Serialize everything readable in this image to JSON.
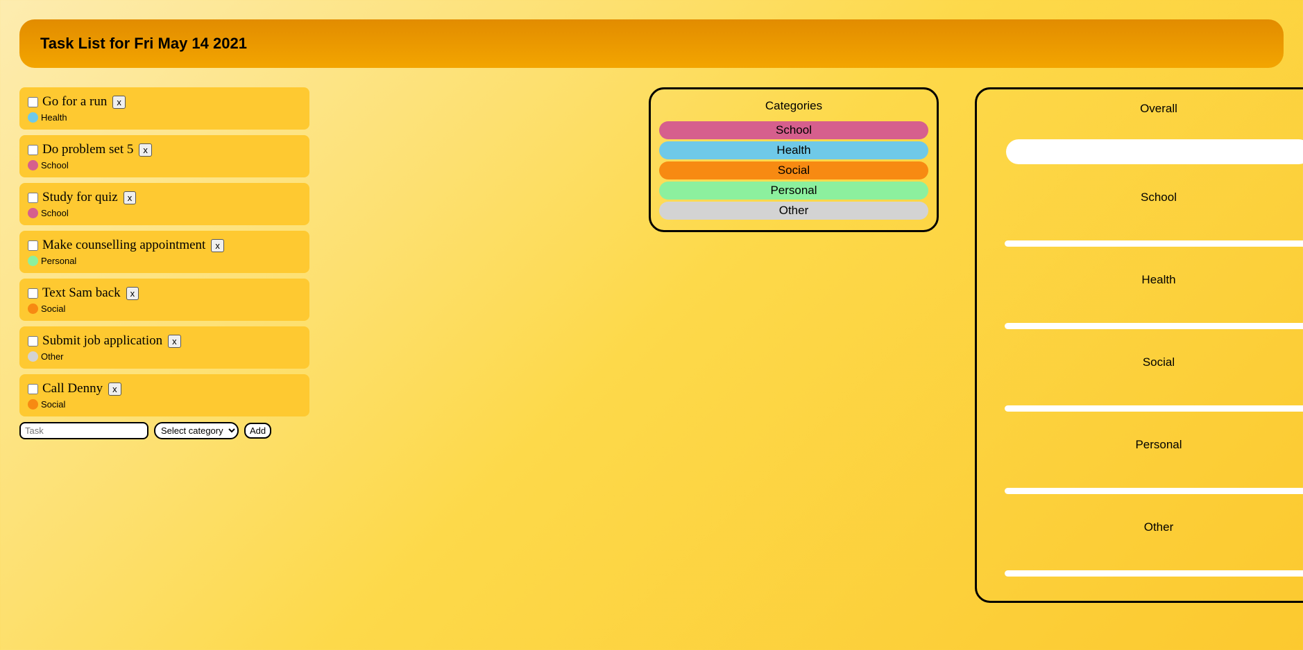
{
  "header": {
    "title": "Task List for Fri May 14 2021"
  },
  "tasks": [
    {
      "label": "Go for a run",
      "category": "Health",
      "color": "#6fc9e8"
    },
    {
      "label": "Do problem set 5",
      "category": "School",
      "color": "#d65f8d"
    },
    {
      "label": "Study for quiz",
      "category": "School",
      "color": "#d65f8d"
    },
    {
      "label": "Make counselling appointment",
      "category": "Personal",
      "color": "#8cf09e"
    },
    {
      "label": "Text Sam back",
      "category": "Social",
      "color": "#f78a12"
    },
    {
      "label": "Submit job application",
      "category": "Other",
      "color": "#d3d3d3"
    },
    {
      "label": "Call Denny",
      "category": "Social",
      "color": "#f78a12"
    }
  ],
  "delete_label": "x",
  "add_form": {
    "placeholder": "Task",
    "select_placeholder": "Select category",
    "add_label": "Add"
  },
  "categories_panel": {
    "title": "Categories",
    "items": [
      {
        "label": "School",
        "color": "#d65f8d"
      },
      {
        "label": "Health",
        "color": "#6fc9e8"
      },
      {
        "label": "Social",
        "color": "#f78a12"
      },
      {
        "label": "Personal",
        "color": "#8cf09e"
      },
      {
        "label": "Other",
        "color": "#d3d3d3"
      }
    ]
  },
  "progress_panel": {
    "sections": [
      {
        "label": "Overall",
        "type": "big",
        "value": 0
      },
      {
        "label": "School",
        "type": "small",
        "value": 0
      },
      {
        "label": "Health",
        "type": "small",
        "value": 0
      },
      {
        "label": "Social",
        "type": "small",
        "value": 0
      },
      {
        "label": "Personal",
        "type": "small",
        "value": 0
      },
      {
        "label": "Other",
        "type": "small",
        "value": 0
      }
    ]
  }
}
